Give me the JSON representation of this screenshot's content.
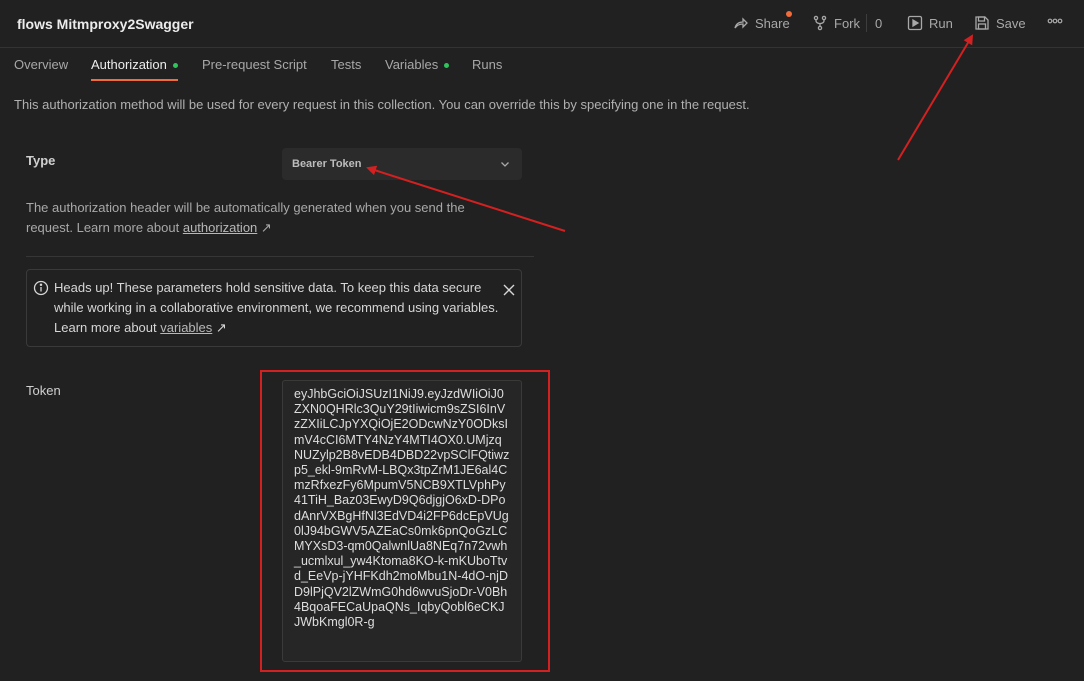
{
  "header": {
    "title": "flows Mitmproxy2Swagger",
    "share_label": "Share",
    "fork_label": "Fork",
    "fork_count": "0",
    "run_label": "Run",
    "save_label": "Save"
  },
  "tabs": [
    {
      "label": "Overview",
      "active": false
    },
    {
      "label": "Authorization",
      "active": true,
      "has_dot": true
    },
    {
      "label": "Pre-request Script",
      "active": false
    },
    {
      "label": "Tests",
      "active": false
    },
    {
      "label": "Variables",
      "active": false,
      "has_dot": true
    },
    {
      "label": "Runs",
      "active": false
    }
  ],
  "description": "This authorization method will be used for every request in this collection. You can override this by specifying one in the request.",
  "auth": {
    "type_label": "Type",
    "type_value": "Bearer Token",
    "help_text": "The authorization header will be automatically generated when you send the request. Learn more about",
    "help_link": "authorization",
    "link_arrow": "↗"
  },
  "notice": {
    "text": "Heads up! These parameters hold sensitive data. To keep this data secure while working in a collaborative environment, we recommend using variables. Learn more about",
    "link": "variables",
    "link_arrow": "↗"
  },
  "token": {
    "label": "Token",
    "value": "eyJhbGciOiJSUzI1NiJ9.eyJzdWIiOiJ0ZXN0QHRlc3QuY29tIiwicm9sZSI6InVzZXIiLCJpYXQiOjE2ODcwNzY0ODksImV4cCI6MTY4NzY4MTI4OX0.UMjzqNUZylp2B8vEDB4DBD22vpSClFQtiwzp5_ekl-9mRvM-LBQx3tpZrM1JE6al4CmzRfxezFy6MpumV5NCB9XTLVphPy41TiH_Baz03EwyD9Q6djgjO6xD-DPodAnrVXBgHfNl3EdVD4i2FP6dcEpVUg0lJ94bGWV5AZEaCs0mk6pnQoGzLCMYXsD3-qm0QalwnlUa8NEq7n72vwh_ucmlxul_yw4Ktoma8KO-k-mKUboTtvd_EeVp-jYHFKdh2moMbu1N-4dO-njDD9lPjQV2lZWmG0hd6wvuSjoDr-V0Bh4BqoaFECaUpaQNs_IqbyQobl6eCKJJWbKmgl0R-g"
  },
  "colors": {
    "accent": "#f26b3a",
    "active_dot": "#2fc45c",
    "annotation_red": "#d32020",
    "background": "#212121"
  }
}
